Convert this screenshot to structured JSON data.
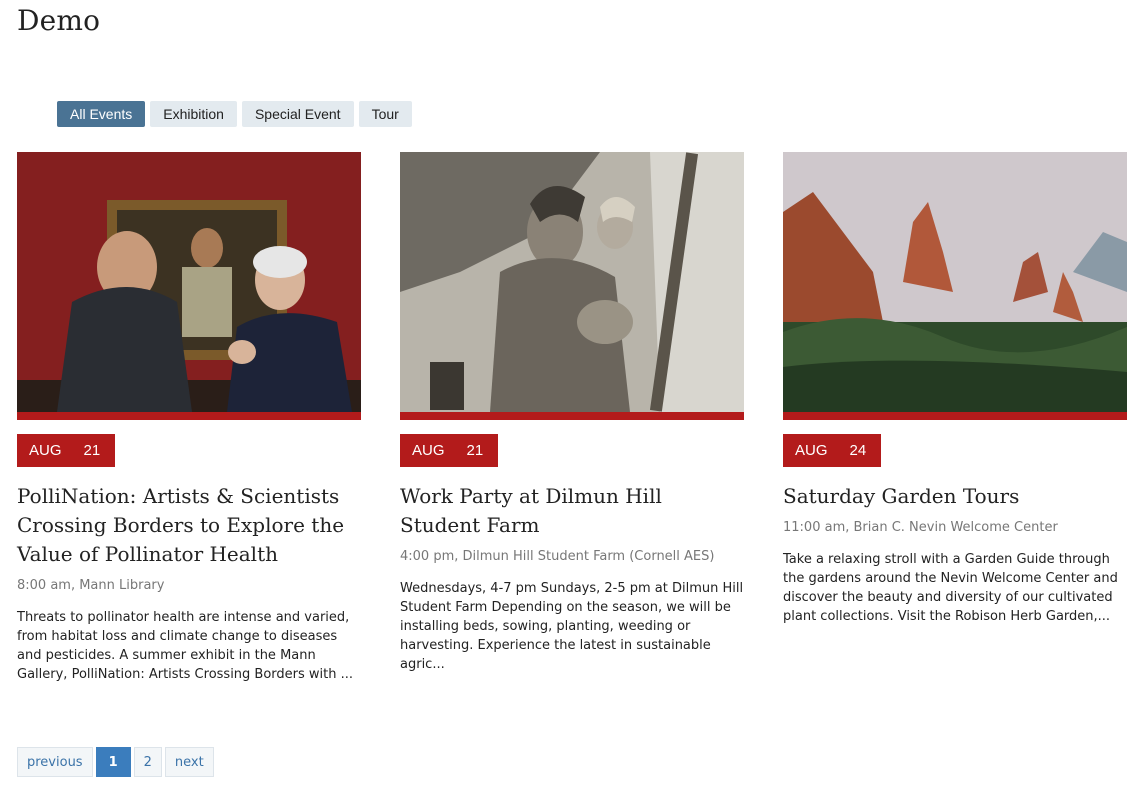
{
  "page": {
    "title": "Demo"
  },
  "filters": [
    "All Events",
    "Exhibition",
    "Special Event",
    "Tour"
  ],
  "events": [
    {
      "month": "AUG",
      "day": "21",
      "title": "PolliNation: Artists & Scientists Crossing Borders to Explore the Value of Pollinator Health",
      "meta": "8:00 am, Mann Library",
      "description": "Threats to pollinator health are intense and varied, from habitat loss and climate change to diseases and pesticides. A summer exhibit in the Mann Gallery, PolliNation: Artists Crossing Borders with ..."
    },
    {
      "month": "AUG",
      "day": "21",
      "title": "Work Party at Dilmun Hill Student Farm",
      "meta": "4:00 pm, Dilmun Hill Student Farm (Cornell AES)",
      "description": "Wednesdays, 4-7 pm Sundays, 2-5 pm at Dilmun Hill Student Farm Depending on the season, we will be installing beds, sowing, planting, weeding or harvesting. Experience the latest in sustainable agric..."
    },
    {
      "month": "AUG",
      "day": "24",
      "title": "Saturday Garden Tours",
      "meta": "11:00 am, Brian C. Nevin Welcome Center",
      "description": "Take a relaxing stroll with a Garden Guide through the gardens around the Nevin Welcome Center and discover the beauty and diversity of our cultivated plant collections. Visit the Robison Herb Garden,..."
    }
  ],
  "pagination": {
    "previous": "previous",
    "pages": [
      "1",
      "2"
    ],
    "next": "next"
  }
}
